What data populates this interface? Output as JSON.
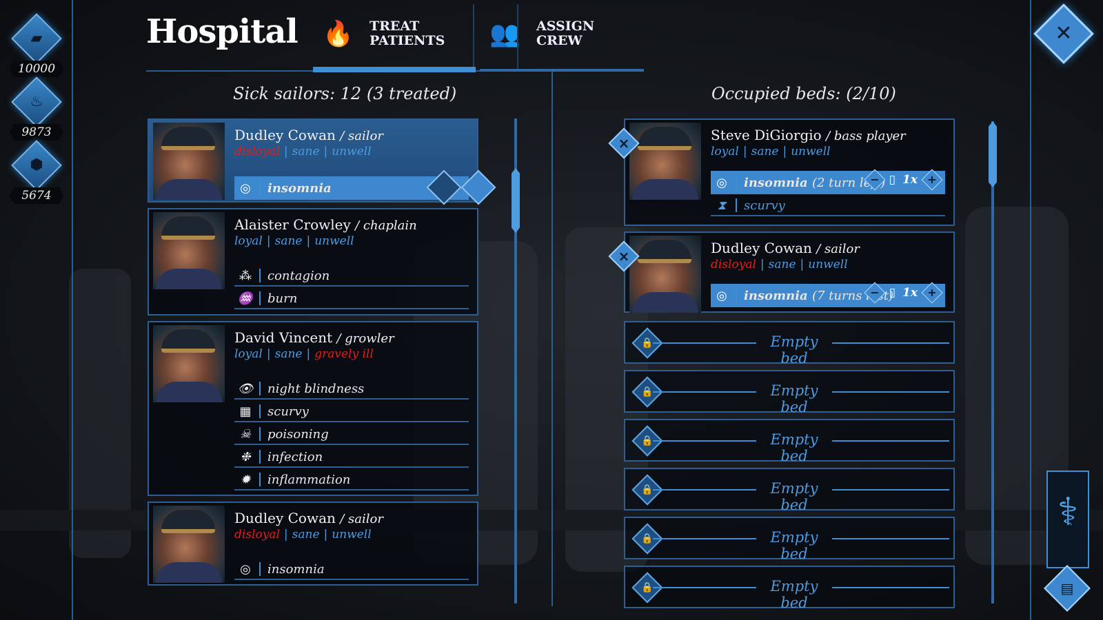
{
  "resources": [
    {
      "icon": "wood-icon",
      "glyph": "▰",
      "value": "10000"
    },
    {
      "icon": "meat-icon",
      "glyph": "♨",
      "value": "9873"
    },
    {
      "icon": "ore-icon",
      "glyph": "⬢",
      "value": "5674"
    }
  ],
  "header": {
    "title": "Hospital",
    "tabs": [
      {
        "icon": "flame-icon",
        "glyph": "🔥",
        "label": "TREAT PATIENTS",
        "active": true
      },
      {
        "icon": "crew-icon",
        "glyph": "👥",
        "label": "ASSIGN CREW",
        "active": false
      }
    ]
  },
  "left": {
    "heading": "Sick sailors: 12 (3 treated)",
    "patients": [
      {
        "name": "Dudley Cowan",
        "role": "/ sailor",
        "traits": [
          {
            "t": "disloyal",
            "c": "red"
          },
          {
            "t": "sane",
            "c": "blue"
          },
          {
            "t": "unwell",
            "c": "blue"
          }
        ],
        "illnesses": [
          {
            "icon": "eye-spiral-icon",
            "glyph": "◎",
            "label": "insomnia",
            "active": true
          }
        ]
      },
      {
        "name": "Alaister Crowley",
        "role": "/ chaplain",
        "traits": [
          {
            "t": "loyal",
            "c": "blue"
          },
          {
            "t": "sane",
            "c": "blue"
          },
          {
            "t": "unwell",
            "c": "blue"
          }
        ],
        "illnesses": [
          {
            "icon": "contagion-icon",
            "glyph": "⁂",
            "label": "contagion"
          },
          {
            "icon": "burn-icon",
            "glyph": "♒",
            "label": "burn"
          }
        ]
      },
      {
        "name": "David Vincent",
        "role": "/ growler",
        "traits": [
          {
            "t": "loyal",
            "c": "blue"
          },
          {
            "t": "sane",
            "c": "blue"
          },
          {
            "t": "gravely ill",
            "c": "red"
          }
        ],
        "illnesses": [
          {
            "icon": "eye-icon",
            "glyph": "👁",
            "label": "night blindness"
          },
          {
            "icon": "teeth-icon",
            "glyph": "▦",
            "label": "scurvy"
          },
          {
            "icon": "poison-icon",
            "glyph": "☠",
            "label": "poisoning"
          },
          {
            "icon": "infection-icon",
            "glyph": "❉",
            "label": "infection"
          },
          {
            "icon": "inflammation-icon",
            "glyph": "✹",
            "label": "inflammation"
          }
        ]
      },
      {
        "name": "Dudley Cowan",
        "role": "/ sailor",
        "traits": [
          {
            "t": "disloyal",
            "c": "red"
          },
          {
            "t": "sane",
            "c": "blue"
          },
          {
            "t": "unwell",
            "c": "blue"
          }
        ],
        "illnesses": [
          {
            "icon": "eye-spiral-icon",
            "glyph": "◎",
            "label": "insomnia"
          }
        ]
      }
    ]
  },
  "right": {
    "heading": "Occupied beds: (2/10)",
    "beds": [
      {
        "name": "Steve DiGiorgio",
        "role": "/ bass player",
        "traits": [
          {
            "t": "loyal",
            "c": "blue"
          },
          {
            "t": "sane",
            "c": "blue"
          },
          {
            "t": "unwell",
            "c": "blue"
          }
        ],
        "treat": {
          "label": "insomnia",
          "detail": "(2 turn left)",
          "qty": "1x"
        },
        "waiting": {
          "label": "scurvy"
        }
      },
      {
        "name": "Dudley Cowan",
        "role": "/ sailor",
        "traits": [
          {
            "t": "disloyal",
            "c": "red"
          },
          {
            "t": "sane",
            "c": "blue"
          },
          {
            "t": "unwell",
            "c": "blue"
          }
        ],
        "treat": {
          "label": "insomnia",
          "detail": "(7 turns lest)",
          "qty": "1x"
        }
      }
    ],
    "empty_label": "Empty bed",
    "empty_count": 6
  },
  "colors": {
    "accent": "#3e88cf",
    "alert": "#e01e1e",
    "text_blue": "#4f9be0"
  }
}
